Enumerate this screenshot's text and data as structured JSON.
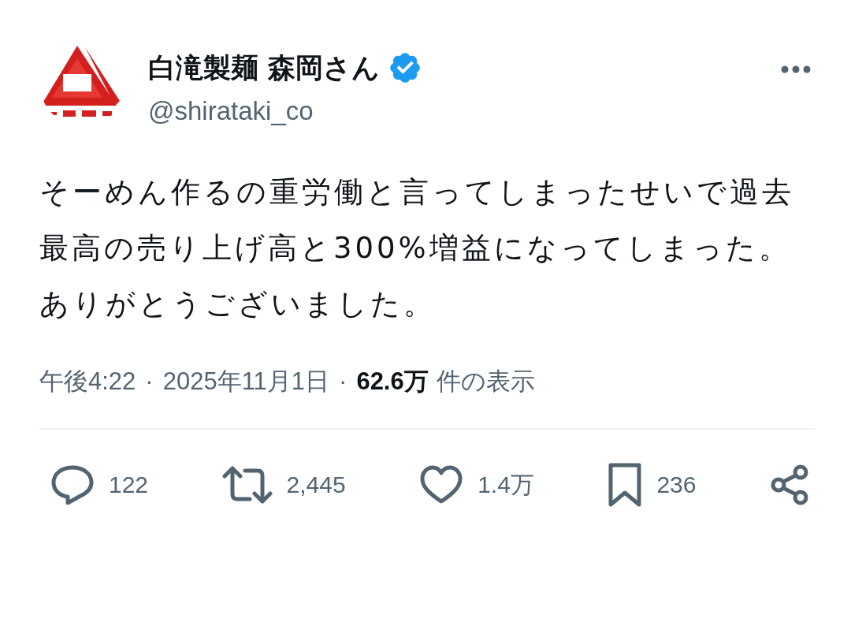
{
  "author": {
    "name": "白滝製麺 森岡さん",
    "verified": true,
    "handle": "@shirataki_co"
  },
  "post": {
    "paragraphs": [
      "そーめん作るの重労働と言ってしまったせいで過去最高の売り上げ高と300%増益になってしまった。",
      "ありがとうございました。"
    ]
  },
  "meta": {
    "time": "午後4:22",
    "separator_1": "·",
    "date": "2025年11月1日",
    "separator_2": "·",
    "views": "62.6万",
    "views_label": "件の表示"
  },
  "actions": [
    {
      "kind": "reply",
      "count": "122"
    },
    {
      "kind": "repost",
      "count": "2,445"
    },
    {
      "kind": "like",
      "count": "1.4万"
    },
    {
      "kind": "bookmark",
      "count": "236"
    },
    {
      "kind": "share"
    }
  ]
}
